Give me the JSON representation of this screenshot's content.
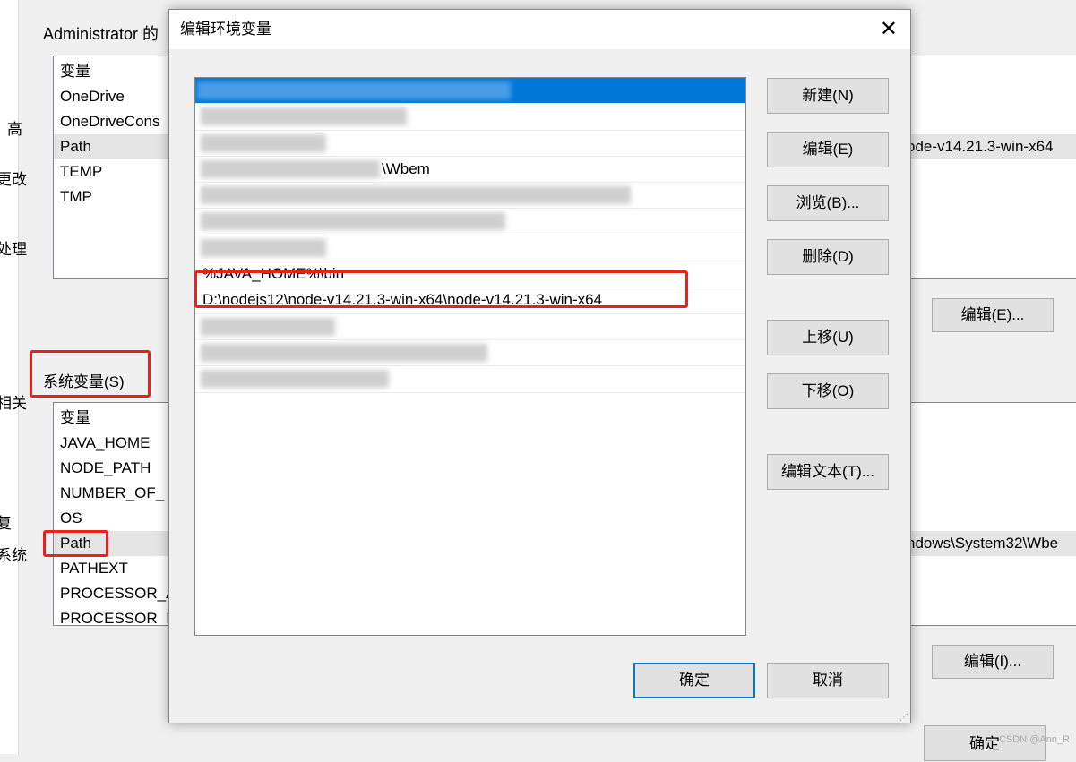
{
  "background_window": {
    "user_group_title": "Administrator 的",
    "user_vars": {
      "header": "变量",
      "rows": [
        "OneDrive",
        "OneDriveCons",
        "Path",
        "TEMP",
        "TMP"
      ],
      "selected_value_fragment": "ode-v14.21.3-win-x64"
    },
    "user_edit_button": "编辑(E)...",
    "system_group_title": "系统变量(S)",
    "system_vars": {
      "header": "变量",
      "rows": [
        "JAVA_HOME",
        "NODE_PATH",
        "NUMBER_OF_",
        "OS",
        "Path",
        "PATHEXT",
        "PROCESSOR_A",
        "PROCESSOR_I"
      ],
      "selected_value_fragment": "ndows\\System32\\Wbe"
    },
    "system_edit_button": "编辑(I)...",
    "ok_button": "确定",
    "side_fragments": [
      "高",
      "更改",
      "处理",
      "相关",
      "复",
      "系统"
    ]
  },
  "dialog": {
    "title": "编辑环境变量",
    "entries": [
      "",
      "",
      "",
      "\\Wbem",
      "",
      "",
      "",
      "%JAVA_HOME%\\bin",
      "D:\\nodejs12\\node-v14.21.3-win-x64\\node-v14.21.3-win-x64",
      "",
      "",
      ""
    ],
    "selected_index": 0,
    "highlighted_index": 8,
    "buttons": {
      "new": "新建(N)",
      "edit": "编辑(E)",
      "browse": "浏览(B)...",
      "delete": "删除(D)",
      "up": "上移(U)",
      "down": "下移(O)",
      "edit_text": "编辑文本(T)..."
    },
    "ok": "确定",
    "cancel": "取消"
  },
  "watermark": "CSDN @Ann_R",
  "colors": {
    "highlight": "#e8211a",
    "selection": "#0078d7"
  }
}
